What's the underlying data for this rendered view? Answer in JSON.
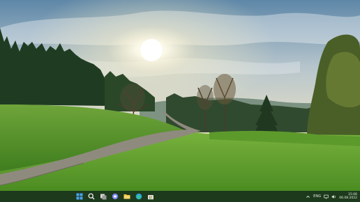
{
  "desktop": {
    "wallpaper": "meadow-with-path-and-trees-at-sunrise"
  },
  "taskbar": {
    "background": "#1d3a1c",
    "apps": [
      {
        "name": "start",
        "icon": "windows-logo-icon",
        "color": "#4aa3f0"
      },
      {
        "name": "search",
        "icon": "search-icon",
        "color": "#ffffff"
      },
      {
        "name": "task-view",
        "icon": "task-view-icon",
        "color": "#d8d8d8"
      },
      {
        "name": "chat",
        "icon": "chat-icon",
        "color": "#7b83eb"
      },
      {
        "name": "file-explorer",
        "icon": "folder-icon",
        "color": "#f4c542"
      },
      {
        "name": "edge",
        "icon": "edge-browser-icon",
        "color": "#2aa6d9"
      },
      {
        "name": "store",
        "icon": "store-icon",
        "color": "#e0e0e0"
      }
    ],
    "tray": {
      "language": "ENG",
      "time": "15:06",
      "date": "06.08.2022"
    }
  }
}
